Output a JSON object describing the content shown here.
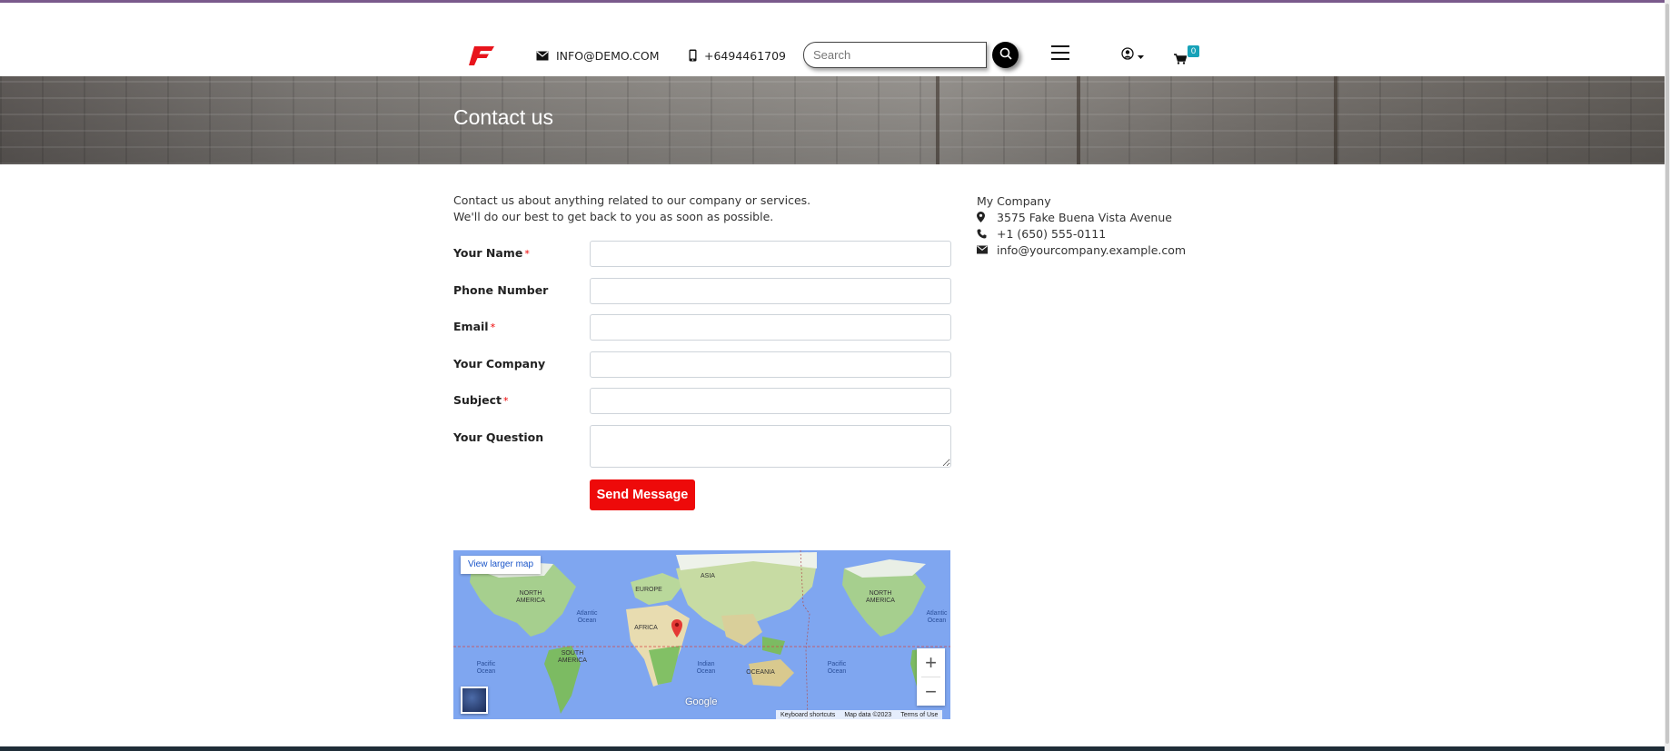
{
  "header": {
    "email": "INFO@DEMO.COM",
    "phone": "+6494461709",
    "search_placeholder": "Search",
    "cart_count": "0"
  },
  "banner": {
    "title": "Contact us"
  },
  "intro": {
    "line1": "Contact us about anything related to our company or services.",
    "line2": "We'll do our best to get back to you as soon as possible."
  },
  "form": {
    "name_label": "Your Name",
    "phone_label": "Phone Number",
    "email_label": "Email",
    "company_label": "Your Company",
    "subject_label": "Subject",
    "question_label": "Your Question",
    "required_mark": "*",
    "send_label": "Send Message"
  },
  "company": {
    "name": "My Company",
    "address": "3575 Fake Buena Vista Avenue",
    "phone": "+1 (650) 555-0111",
    "email": "info@yourcompany.example.com"
  },
  "map": {
    "larger_map": "View larger map",
    "labels": {
      "north_america_1": "NORTH AMERICA",
      "europe": "EUROPE",
      "asia": "ASIA",
      "atlantic_1": "Atlantic Ocean",
      "africa": "AFRICA",
      "north_america_2": "NORTH AMERICA",
      "atlantic_2": "Atlantic Ocean",
      "south_america_1": "SOUTH AMERICA",
      "pacific_1": "Pacific Ocean",
      "indian": "Indian Ocean",
      "oceania": "OCEANIA",
      "pacific_2": "Pacific Ocean"
    },
    "zoom_in": "+",
    "zoom_out": "−",
    "google": "Google",
    "footer": {
      "shortcuts": "Keyboard shortcuts",
      "data": "Map data ©2023",
      "terms": "Terms of Use"
    }
  },
  "colors": {
    "accent_red": "#ee0a0a",
    "badge": "#17a2b8",
    "top_line": "#7a5a8c"
  }
}
